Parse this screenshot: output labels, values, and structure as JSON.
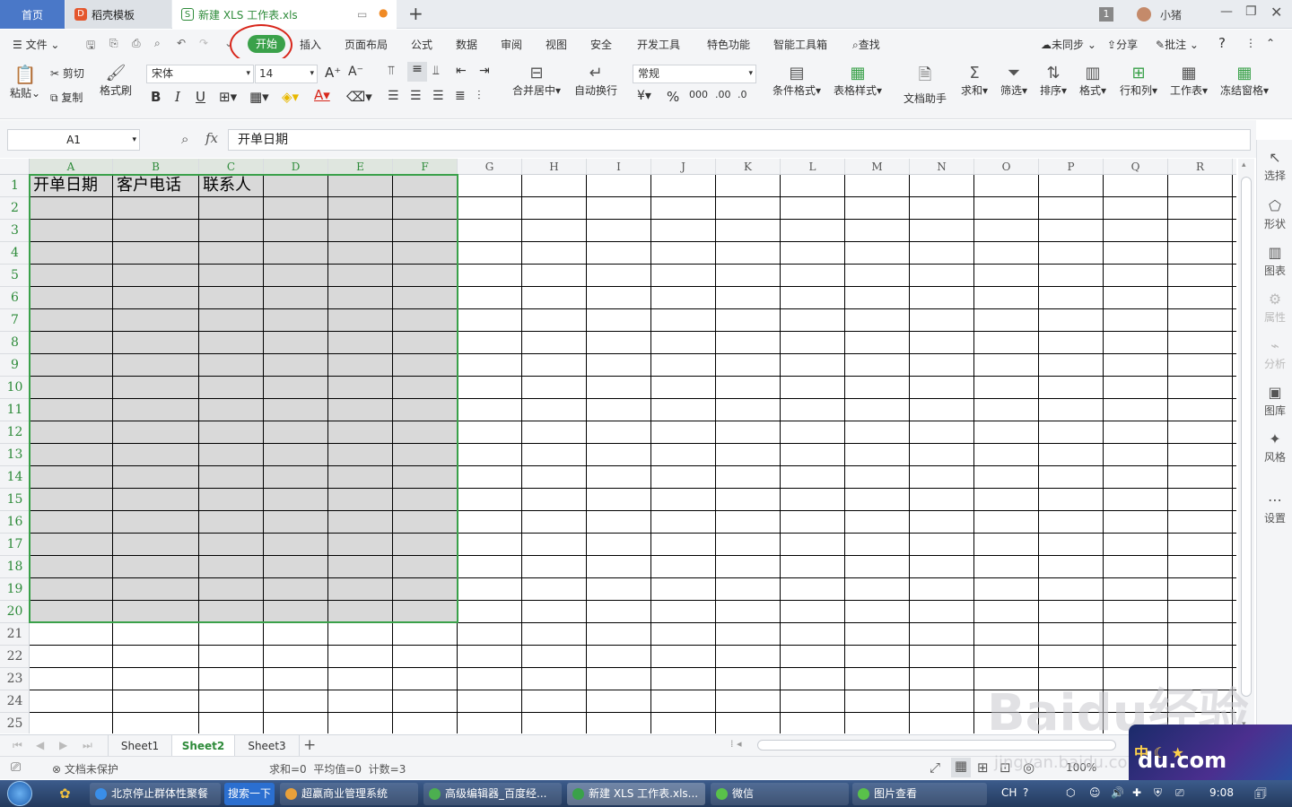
{
  "tabs": {
    "home": "首页",
    "template": "稻壳模板",
    "doc": "新建 XLS 工作表.xls",
    "page_count": "1",
    "user": "小猪"
  },
  "menu": {
    "file": "文件",
    "start": "开始",
    "insert": "插入",
    "layout": "页面布局",
    "formula": "公式",
    "data": "数据",
    "review": "审阅",
    "view": "视图",
    "security": "安全",
    "devtools": "开发工具",
    "special": "特色功能",
    "smarttools": "智能工具箱",
    "find": "查找",
    "sync": "未同步",
    "share": "分享",
    "comment": "批注",
    "help": "?"
  },
  "ribbon": {
    "paste": "粘贴",
    "cut": "剪切",
    "copy": "复制",
    "format_painter": "格式刷",
    "font_name": "宋体",
    "font_size": "14",
    "merge": "合并居中",
    "wrap": "自动换行",
    "number_format": "常规",
    "cond_format": "条件格式",
    "table_style": "表格样式",
    "doc_helper": "文档助手",
    "sum": "求和",
    "filter": "筛选",
    "sort": "排序",
    "format": "格式",
    "rowcol": "行和列",
    "worksheet": "工作表",
    "freeze": "冻结窗格"
  },
  "formula": {
    "namebox": "A1",
    "fx": "fx",
    "content": "开单日期"
  },
  "columns": [
    "A",
    "B",
    "C",
    "D",
    "E",
    "F",
    "G",
    "H",
    "I",
    "J",
    "K",
    "L",
    "M",
    "N",
    "O",
    "P",
    "Q",
    "R"
  ],
  "rows": [
    "1",
    "2",
    "3",
    "4",
    "5",
    "6",
    "7",
    "8",
    "9",
    "10",
    "11",
    "12",
    "13",
    "14",
    "15",
    "16",
    "17",
    "18",
    "19",
    "20",
    "21",
    "22",
    "23",
    "24",
    "25"
  ],
  "cells": {
    "A1": "开单日期",
    "B1": "客户电话",
    "C1": "联系人"
  },
  "rightpanel": [
    "选择",
    "形状",
    "图表",
    "属性",
    "分析",
    "图库",
    "风格",
    "设置"
  ],
  "sheets": [
    "Sheet1",
    "Sheet2",
    "Sheet3"
  ],
  "status": {
    "protect": "文档未保护",
    "stats": "求和=0  平均值=0  计数=3",
    "zoom": "100%"
  },
  "taskbar": {
    "items": [
      "北京停止群体性聚餐",
      "搜索一下",
      "超赢商业管理系统",
      "高级编辑器_百度经...",
      "新建 XLS 工作表.xls...",
      "微信",
      "图片查看"
    ],
    "lang": "CH",
    "time": "9:08"
  },
  "watermark": {
    "brand": "Baidu经验",
    "url": "jingyan.baidu.com",
    "badge": "du.com"
  }
}
